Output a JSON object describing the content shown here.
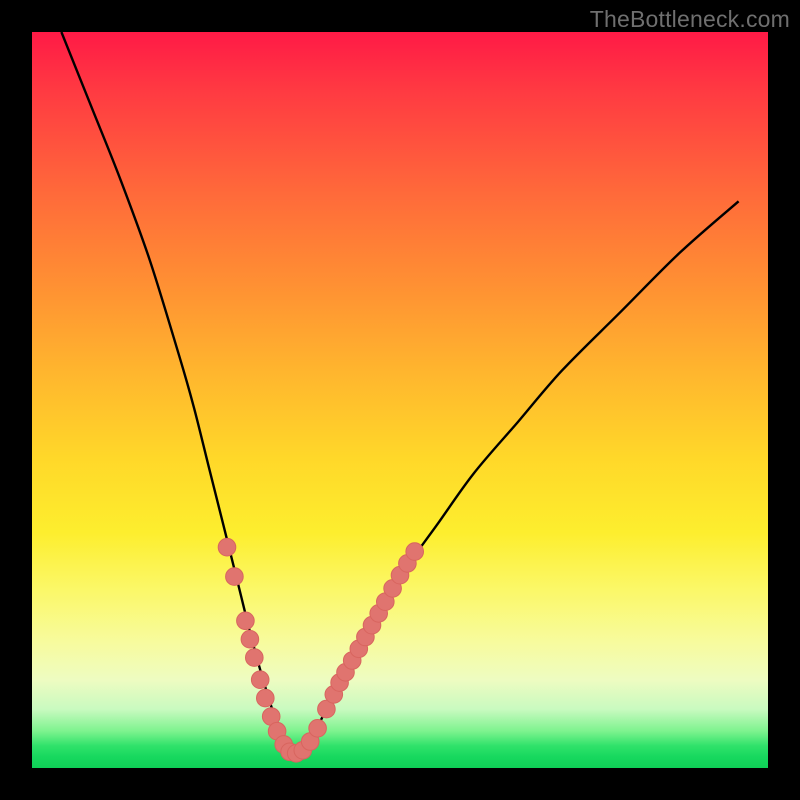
{
  "watermark": "TheBottleneck.com",
  "colors": {
    "frame": "#000000",
    "curve": "#000000",
    "marker_fill": "#e0746f",
    "marker_stroke": "#d8655f",
    "gradient_stops": [
      "#ff1a46",
      "#ff6a3a",
      "#ffb52e",
      "#fdee2e",
      "#f7fb9e",
      "#7df38e",
      "#17d85e"
    ]
  },
  "chart_data": {
    "type": "line",
    "title": "",
    "xlabel": "",
    "ylabel": "",
    "xlim": [
      0,
      100
    ],
    "ylim": [
      0,
      100
    ],
    "description": "Abstract V-shaped bottleneck curve. Y appears to represent bottleneck percentage (red≈high, green≈low). X is an unlabeled component-balance axis. Curve minimum (≈0% bottleneck) near x≈35. Salmon dots mark sample points near the valley walls.",
    "series": [
      {
        "name": "bottleneck-curve",
        "x": [
          4,
          8,
          12,
          16,
          20,
          22,
          24,
          26,
          28,
          30,
          32,
          34,
          35,
          36,
          38,
          40,
          43,
          46,
          50,
          55,
          60,
          66,
          72,
          80,
          88,
          96
        ],
        "values": [
          100,
          90,
          80,
          69,
          56,
          49,
          41,
          33,
          25,
          17,
          10,
          4,
          2,
          2,
          4,
          8,
          13,
          19,
          26,
          33,
          40,
          47,
          54,
          62,
          70,
          77
        ]
      }
    ],
    "markers": [
      {
        "x": 26.5,
        "y": 30
      },
      {
        "x": 27.5,
        "y": 26
      },
      {
        "x": 29.0,
        "y": 20
      },
      {
        "x": 29.6,
        "y": 17.5
      },
      {
        "x": 30.2,
        "y": 15
      },
      {
        "x": 31.0,
        "y": 12
      },
      {
        "x": 31.7,
        "y": 9.5
      },
      {
        "x": 32.5,
        "y": 7
      },
      {
        "x": 33.3,
        "y": 5
      },
      {
        "x": 34.2,
        "y": 3.2
      },
      {
        "x": 35.0,
        "y": 2.2
      },
      {
        "x": 35.9,
        "y": 2.0
      },
      {
        "x": 36.8,
        "y": 2.4
      },
      {
        "x": 37.8,
        "y": 3.6
      },
      {
        "x": 38.8,
        "y": 5.4
      },
      {
        "x": 40.0,
        "y": 8.0
      },
      {
        "x": 41.0,
        "y": 10.0
      },
      {
        "x": 41.8,
        "y": 11.6
      },
      {
        "x": 42.6,
        "y": 13.0
      },
      {
        "x": 43.5,
        "y": 14.6
      },
      {
        "x": 44.4,
        "y": 16.2
      },
      {
        "x": 45.3,
        "y": 17.8
      },
      {
        "x": 46.2,
        "y": 19.4
      },
      {
        "x": 47.1,
        "y": 21.0
      },
      {
        "x": 48.0,
        "y": 22.6
      },
      {
        "x": 49.0,
        "y": 24.4
      },
      {
        "x": 50.0,
        "y": 26.2
      },
      {
        "x": 51.0,
        "y": 27.8
      },
      {
        "x": 52.0,
        "y": 29.4
      }
    ]
  }
}
